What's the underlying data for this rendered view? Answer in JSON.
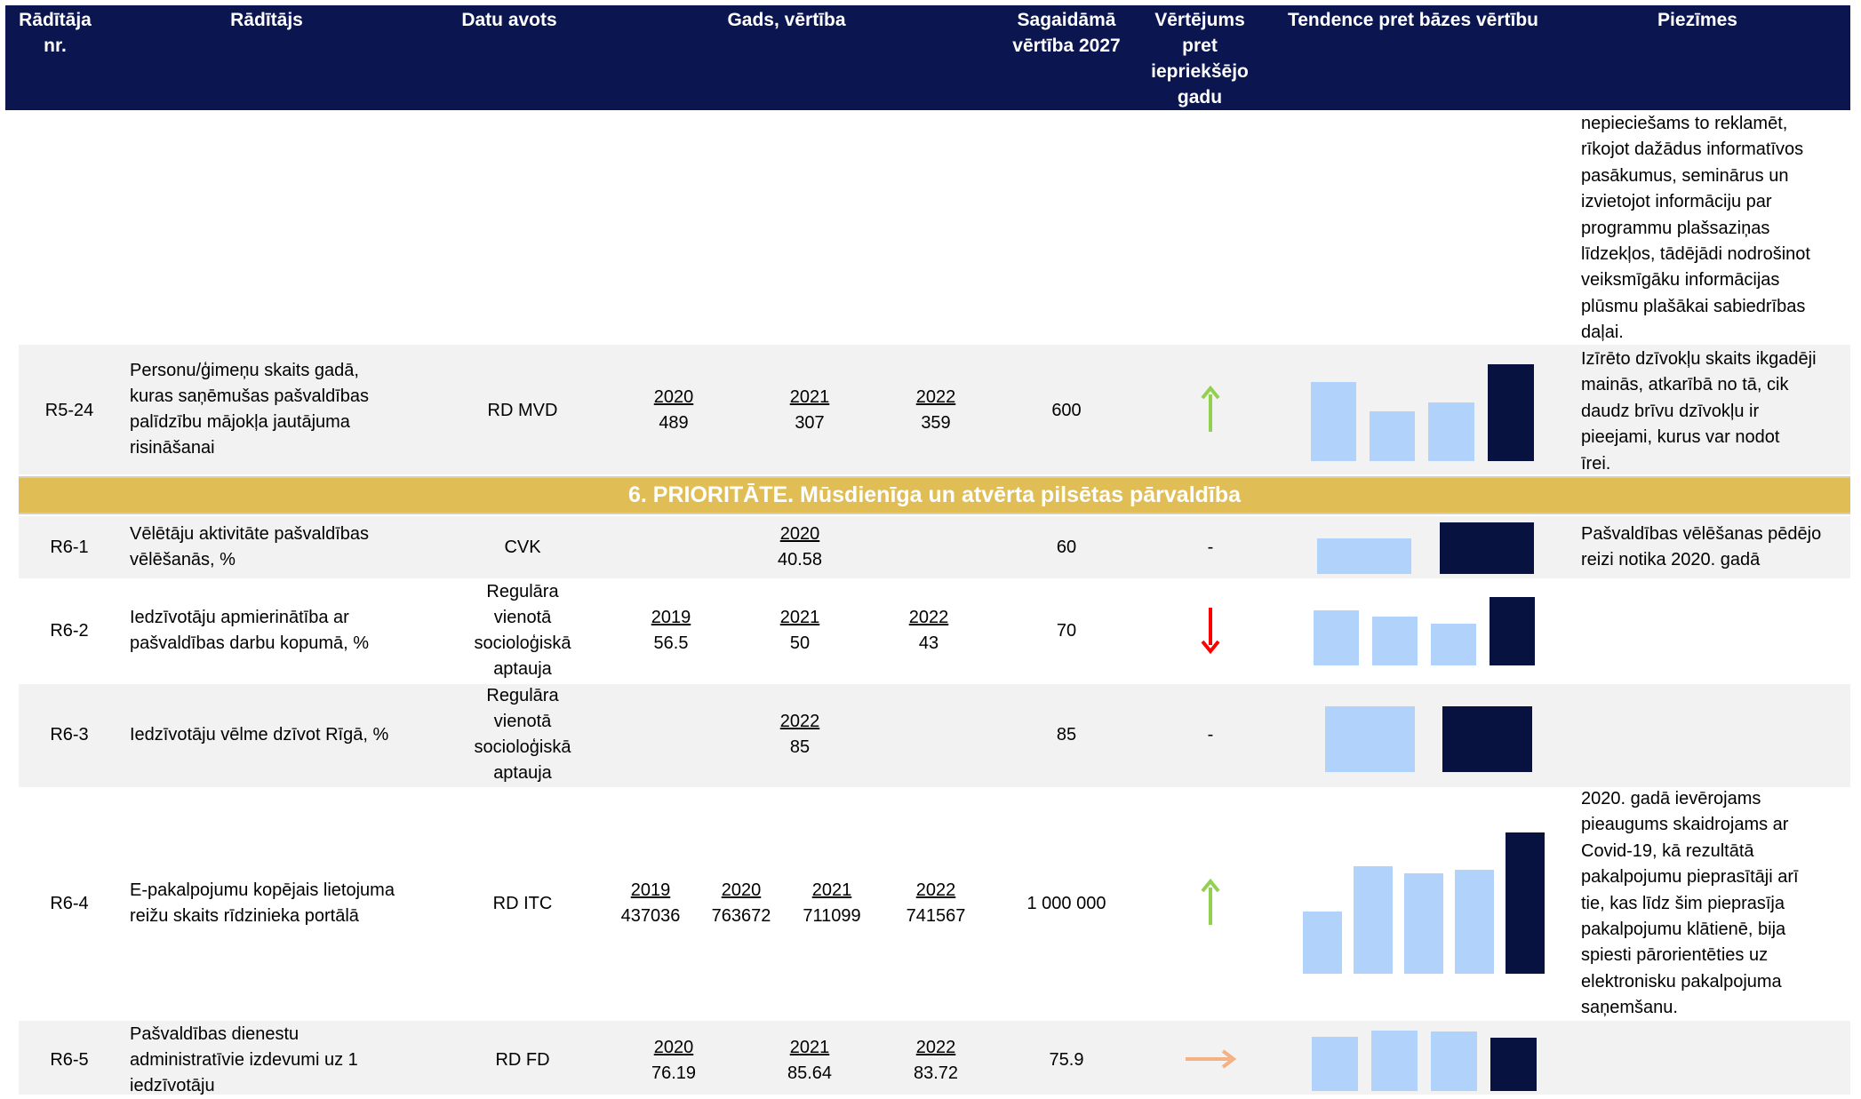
{
  "header": {
    "col_nr": [
      "Rādītāja",
      "nr."
    ],
    "col_indicator": "Rādītājs",
    "col_source": "Datu avots",
    "col_year_value": "Gads, vērtība",
    "col_target": [
      "Sagaidāmā",
      "vērtība 2027"
    ],
    "col_assessment": [
      "Vērtējums",
      "pret",
      "iepriekšējo",
      "gadu"
    ],
    "col_trend": "Tendence pret bāzes vērtību",
    "col_notes": "Piezīmes"
  },
  "continued_note": [
    "nepieciešams to reklamēt,",
    "rīkojot dažādus informatīvos",
    "pasākumus, seminārus un",
    "izvietojot informāciju par",
    "programmu plašsaziņas",
    "līdzekļos, tādējādi nodrošinot",
    "veiksmīgāku informācijas",
    "plūsmu plašākai sabiedrības",
    "daļai."
  ],
  "priority": "6.   PRIORITĀTE. Mūsdienīga un atvērta pilsētas pārvaldība",
  "rows": {
    "r524": {
      "id": "R5-24",
      "indicator": [
        "Personu/ģimeņu skaits gadā,",
        "kuras saņēmušas pašvaldības",
        "palīdzību mājokļa jautājuma",
        "risināšanai"
      ],
      "source": [
        "RD MVD"
      ],
      "years": [
        {
          "year": "2020",
          "value": "489"
        },
        {
          "year": "2021",
          "value": "307"
        },
        {
          "year": "2022",
          "value": "359"
        }
      ],
      "target": "600",
      "assessment": "up-green",
      "trend_values": [
        489,
        307,
        359,
        600
      ],
      "note": [
        "Izīrēto dzīvokļu skaits ikgadēji",
        "mainās, atkarībā no tā, cik",
        "daudz brīvu dzīvokļu ir",
        "pieejami, kurus var nodot",
        "īrei."
      ]
    },
    "r61": {
      "id": "R6-1",
      "indicator": [
        "Vēlētāju aktivitāte pašvaldības",
        "vēlēšanās, %"
      ],
      "source": [
        "CVK"
      ],
      "years": [
        {
          "year": "2020",
          "value": "40.58"
        }
      ],
      "target": "60",
      "assessment": "-",
      "trend_values": [
        40.58,
        60
      ],
      "note": [
        "Pašvaldības vēlēšanas pēdējo",
        "reizi notika 2020. gadā"
      ]
    },
    "r62": {
      "id": "R6-2",
      "indicator": [
        "Iedzīvotāju apmierinātība ar",
        "pašvaldības darbu kopumā, %"
      ],
      "source": [
        "Regulāra",
        "vienotā",
        "socioloģiskā",
        "aptauja"
      ],
      "years": [
        {
          "year": "2019",
          "value": "56.5"
        },
        {
          "year": "2021",
          "value": "50"
        },
        {
          "year": "2022",
          "value": "43"
        }
      ],
      "target": "70",
      "assessment": "down-red",
      "trend_values": [
        56.5,
        50,
        43,
        70
      ],
      "note": []
    },
    "r63": {
      "id": "R6-3",
      "indicator": [
        "Iedzīvotāju vēlme dzīvot Rīgā, %"
      ],
      "source": [
        "Regulāra",
        "vienotā",
        "socioloģiskā",
        "aptauja"
      ],
      "years": [
        {
          "year": "2022",
          "value": "85"
        }
      ],
      "target": "85",
      "assessment": "-",
      "trend_values": [
        85,
        85
      ],
      "note": []
    },
    "r64": {
      "id": "R6-4",
      "indicator": [
        "E-pakalpojumu kopējais lietojuma",
        "reižu skaits rīdzinieka portālā"
      ],
      "source": [
        "RD ITC"
      ],
      "years": [
        {
          "year": "2019",
          "value": "437036"
        },
        {
          "year": "2020",
          "value": "763672"
        },
        {
          "year": "2021",
          "value": "711099"
        },
        {
          "year": "2022",
          "value": "741567"
        }
      ],
      "target": "1 000 000",
      "assessment": "up-green",
      "trend_values": [
        437036,
        763672,
        711099,
        741567,
        1000000
      ],
      "note": [
        "2020. gadā ievērojams",
        "pieaugums skaidrojams ar",
        "Covid-19, kā rezultātā",
        "pakalpojumu pieprasītāji arī",
        "tie, kas līdz šim pieprasīja",
        "pakalpojumu klātienē, bija",
        "spiesti pārorientēties uz",
        "elektronisku pakalpojuma",
        "saņemšanu."
      ]
    },
    "r65": {
      "id": "R6-5",
      "indicator": [
        "Pašvaldības dienestu",
        "administratīvie izdevumi uz 1",
        "iedzīvotāju"
      ],
      "source": [
        "RD FD"
      ],
      "years": [
        {
          "year": "2020",
          "value": "76.19"
        },
        {
          "year": "2021",
          "value": "85.64"
        },
        {
          "year": "2022",
          "value": "83.72"
        }
      ],
      "target": "75.9",
      "assessment": "right-orange",
      "trend_values": [
        76.19,
        85.64,
        83.72,
        75.9
      ],
      "note": []
    }
  },
  "colors": {
    "header_bg": "#0b1650",
    "priority_bg": "#e0bd55",
    "bar_light": "#b1d2fb",
    "bar_dark": "#081241",
    "arrow_green": "#92d050",
    "arrow_red": "#ff0000",
    "arrow_orange": "#f4b183",
    "row_bg": "#f2f2f2"
  }
}
